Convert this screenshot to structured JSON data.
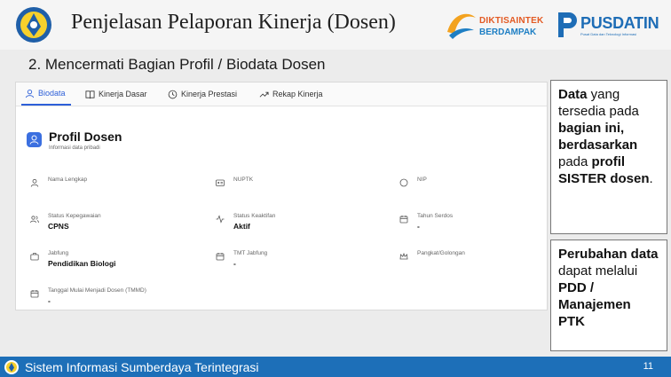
{
  "slide": {
    "title": "Penjelasan Pelaporan Kinerja (Dosen)",
    "subtitle": "2. Mencermati Bagian Profil / Biodata Dosen",
    "page_number": "11"
  },
  "brands": {
    "diktisaintek_line1": "DIKTISAINTEK",
    "diktisaintek_line2": "BERDAMPAK",
    "pusdatin": "PUSDATIN",
    "pusdatin_tagline": "Pusat Data dan Teknologi Informasi"
  },
  "app": {
    "tabs": [
      {
        "label": "Biodata",
        "icon": "user-icon",
        "active": true
      },
      {
        "label": "Kinerja Dasar",
        "icon": "book-icon",
        "active": false
      },
      {
        "label": "Kinerja Prestasi",
        "icon": "clock-icon",
        "active": false
      },
      {
        "label": "Rekap Kinerja",
        "icon": "trend-icon",
        "active": false
      }
    ],
    "profile": {
      "title": "Profil Dosen",
      "subtitle": "Informasi data pribadi"
    },
    "fields": [
      {
        "label": "Nama Lengkap",
        "value": "",
        "icon": "user-icon"
      },
      {
        "label": "NUPTK",
        "value": "",
        "icon": "id-card-icon"
      },
      {
        "label": "NIP",
        "value": "",
        "icon": "circle-icon"
      },
      {
        "label": "Status Kepegawaian",
        "value": "CPNS",
        "icon": "users-icon"
      },
      {
        "label": "Status Keaktifan",
        "value": "Aktif",
        "icon": "activity-icon"
      },
      {
        "label": "Tahun Serdos",
        "value": "-",
        "icon": "calendar-icon"
      },
      {
        "label": "Jabfung",
        "value": "Pendidikan Biologi",
        "icon": "briefcase-icon"
      },
      {
        "label": "TMT Jabfung",
        "value": "-",
        "icon": "calendar-icon"
      },
      {
        "label": "Pangkat/Golongan",
        "value": "",
        "icon": "crown-icon"
      },
      {
        "label": "Tanggal Mulai Menjadi Dosen (TMMD)",
        "value": "-",
        "icon": "calendar-icon"
      }
    ]
  },
  "notes": {
    "note1": {
      "w1": "Data",
      "t1": " yang tersedia pada ",
      "w2": "bagian ini, berdasarkan",
      "t2": " pada ",
      "w3": "profil SISTER",
      "t3": " ",
      "w4": "dosen",
      "t4": "."
    },
    "note2": {
      "w1": "Perubahan data",
      "t1": " dapat melalui ",
      "w2": "PDD / Manajemen PTK",
      "t2": ""
    }
  },
  "footer": {
    "text": "Sistem Informasi Sumberdaya Terintegrasi"
  },
  "colors": {
    "accent": "#2d5fd8",
    "footer": "#1d6fb8",
    "diktisaintek_orange": "#e35a23",
    "pusdatin_blue": "#1e6db6"
  }
}
